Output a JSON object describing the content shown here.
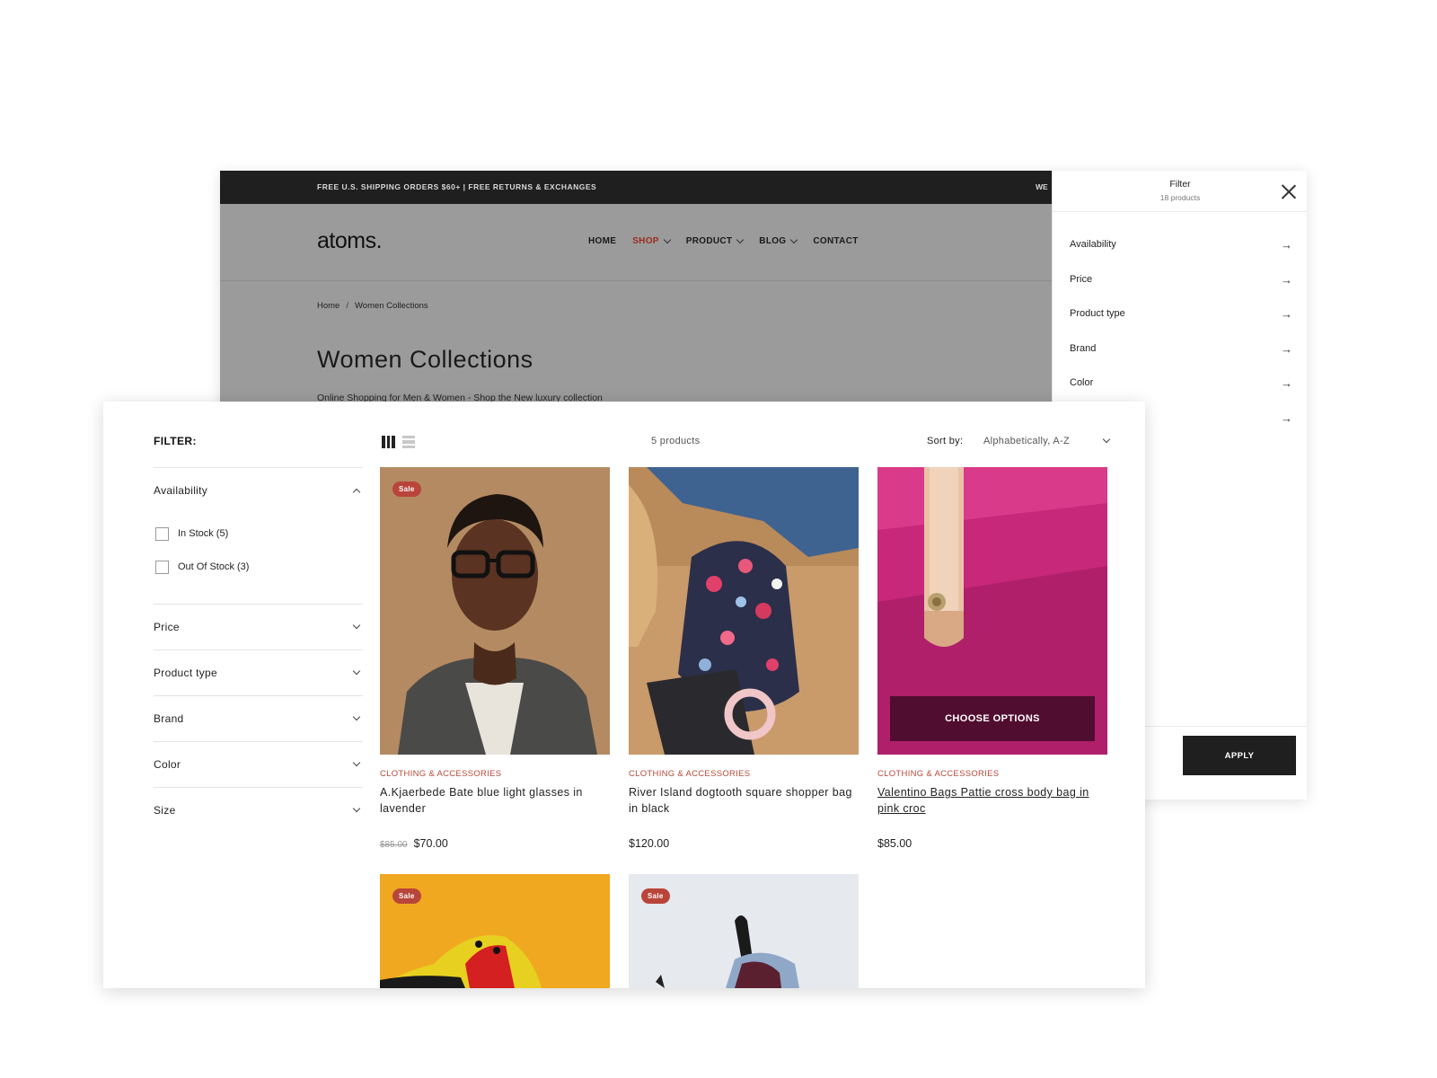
{
  "announcement": {
    "text": "FREE U.S. SHIPPING ORDERS $60+ | FREE RETURNS & EXCHANGES",
    "right_fragment": "WE"
  },
  "store": {
    "logo": "atoms.",
    "nav": [
      {
        "label": "HOME",
        "dropdown": false,
        "active": false
      },
      {
        "label": "SHOP",
        "dropdown": true,
        "active": true
      },
      {
        "label": "PRODUCT",
        "dropdown": true,
        "active": false
      },
      {
        "label": "BLOG",
        "dropdown": true,
        "active": false
      },
      {
        "label": "CONTACT",
        "dropdown": false,
        "active": false
      }
    ],
    "breadcrumb": {
      "home": "Home",
      "separator": "/",
      "current": "Women Collections"
    },
    "title": "Women Collections",
    "description": "Online Shopping for Men & Women - Shop the New luxury collection"
  },
  "drawer": {
    "title": "Filter",
    "count": "18 products",
    "items": [
      "Availability",
      "Price",
      "Product type",
      "Brand",
      "Color",
      ""
    ],
    "arrow_glyph": "→",
    "apply_label": "APPLY"
  },
  "filters": {
    "title": "FILTER:",
    "availability": {
      "label": "Availability",
      "options": [
        "In Stock (5)",
        "Out Of Stock (3)"
      ]
    },
    "groups": [
      "Price",
      "Product type",
      "Brand",
      "Color",
      "Size"
    ]
  },
  "toolbar": {
    "count": "5 products",
    "sort_label": "Sort by:",
    "sort_value": "Alphabetically, A-Z"
  },
  "products": [
    {
      "category": "CLOTHING & ACCESSORIES",
      "name": "A.Kjaerbede Bate blue light glasses in lavender",
      "old_price": "$85.00",
      "price": "$70.00",
      "badge": "Sale"
    },
    {
      "category": "CLOTHING & ACCESSORIES",
      "name": "River Island dogtooth square shopper bag in black",
      "price": "$120.00"
    },
    {
      "category": "CLOTHING & ACCESSORIES",
      "name": "Valentino Bags Pattie cross body bag in pink croc",
      "price": "$85.00",
      "action": "CHOOSE OPTIONS"
    },
    {
      "badge": "Sale"
    },
    {
      "badge": "Sale"
    }
  ],
  "colors": {
    "accent": "#b5483a",
    "sale_badge": "#b9453a",
    "dark": "#1f1f1f",
    "overlay": "#9b9b9b"
  }
}
